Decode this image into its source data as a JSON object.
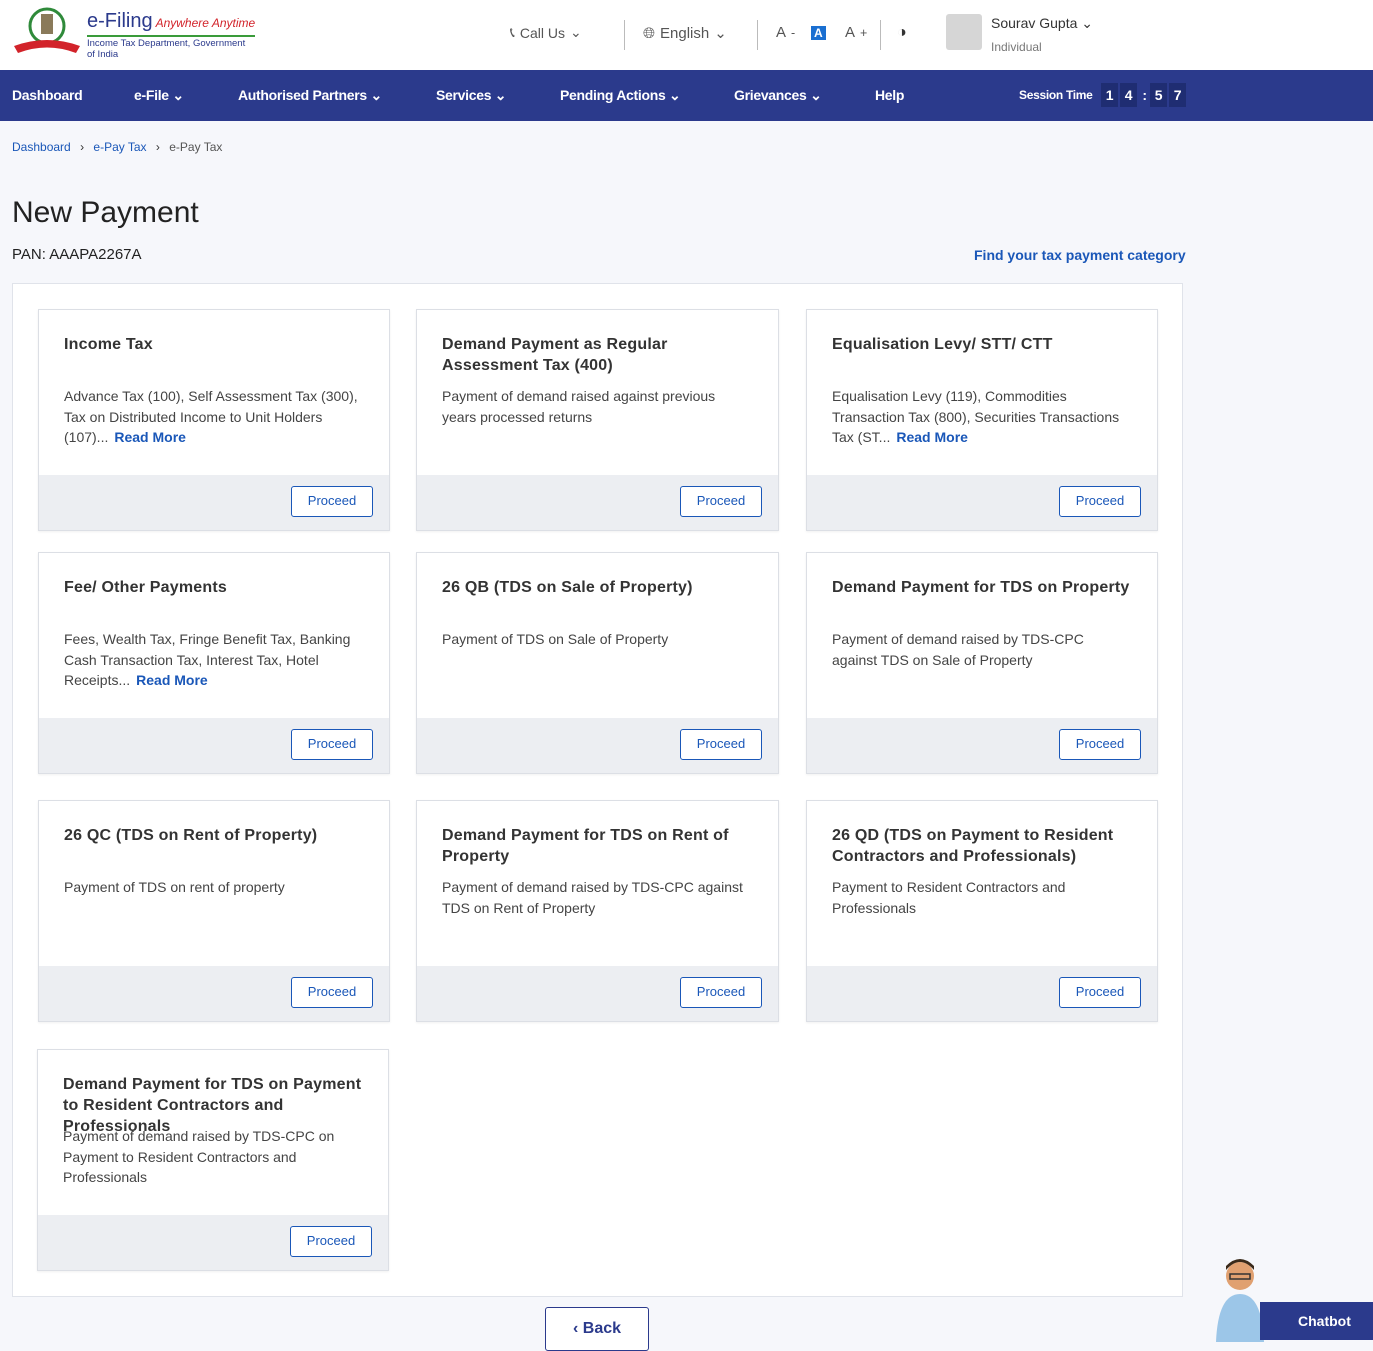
{
  "header": {
    "brand": "e-Filing",
    "tagline": "Anywhere Anytime",
    "dept": "Income Tax Department, Government of India",
    "call_us": "Call Us",
    "language": "English",
    "user_name": "Sourav Gupta",
    "user_role": "Individual"
  },
  "nav": {
    "items": [
      "Dashboard",
      "e-File",
      "Authorised Partners",
      "Services",
      "Pending Actions",
      "Grievances",
      "Help"
    ],
    "session_label": "Session Time",
    "session_digits": [
      "1",
      "4",
      ":",
      "5",
      "7"
    ]
  },
  "breadcrumb": [
    "Dashboard",
    "e-Pay Tax",
    "e-Pay Tax"
  ],
  "page": {
    "title": "New Payment",
    "pan": "PAN: AAAPA2267A",
    "find_link": "Find your tax payment category"
  },
  "cards": [
    {
      "title": "Income Tax",
      "desc": "Advance Tax (100), Self Assessment Tax (300), Tax on Distributed Income to Unit Holders (107)...",
      "read_more": "Read More",
      "button": "Proceed"
    },
    {
      "title": "Demand Payment as Regular Assessment Tax (400)",
      "desc": "Payment of demand raised against previous years processed returns",
      "button": "Proceed"
    },
    {
      "title": "Equalisation Levy/ STT/ CTT",
      "desc": "Equalisation Levy (119), Commodities Transaction Tax (800), Securities Transactions Tax (ST...",
      "read_more": "Read More",
      "button": "Proceed"
    },
    {
      "title": "Fee/ Other Payments",
      "desc": "Fees, Wealth Tax, Fringe Benefit Tax, Banking Cash Transaction Tax, Interest Tax, Hotel Receipts...",
      "read_more": "Read More",
      "button": "Proceed"
    },
    {
      "title": "26 QB (TDS on Sale of Property)",
      "desc": "Payment of TDS on Sale of Property",
      "button": "Proceed"
    },
    {
      "title": "Demand Payment for TDS on Property",
      "desc": "Payment of demand raised by TDS-CPC against TDS on Sale of Property",
      "button": "Proceed"
    },
    {
      "title": "26 QC (TDS on Rent of Property)",
      "desc": "Payment of TDS on rent of property",
      "button": "Proceed"
    },
    {
      "title": "Demand Payment for TDS on Rent of Property",
      "desc": "Payment of demand raised by TDS-CPC against TDS on Rent of Property",
      "button": "Proceed"
    },
    {
      "title": "26 QD (TDS on Payment to Resident Contractors and Professionals)",
      "desc": "Payment to Resident Contractors and Professionals",
      "button": "Proceed"
    },
    {
      "title": "Demand Payment for TDS on Payment to Resident Contractors and Professionals",
      "desc": "Payment of demand raised by TDS-CPC on Payment to Resident Contractors and Professionals",
      "button": "Proceed"
    }
  ],
  "back": "Back",
  "chatbot": "Chatbot"
}
